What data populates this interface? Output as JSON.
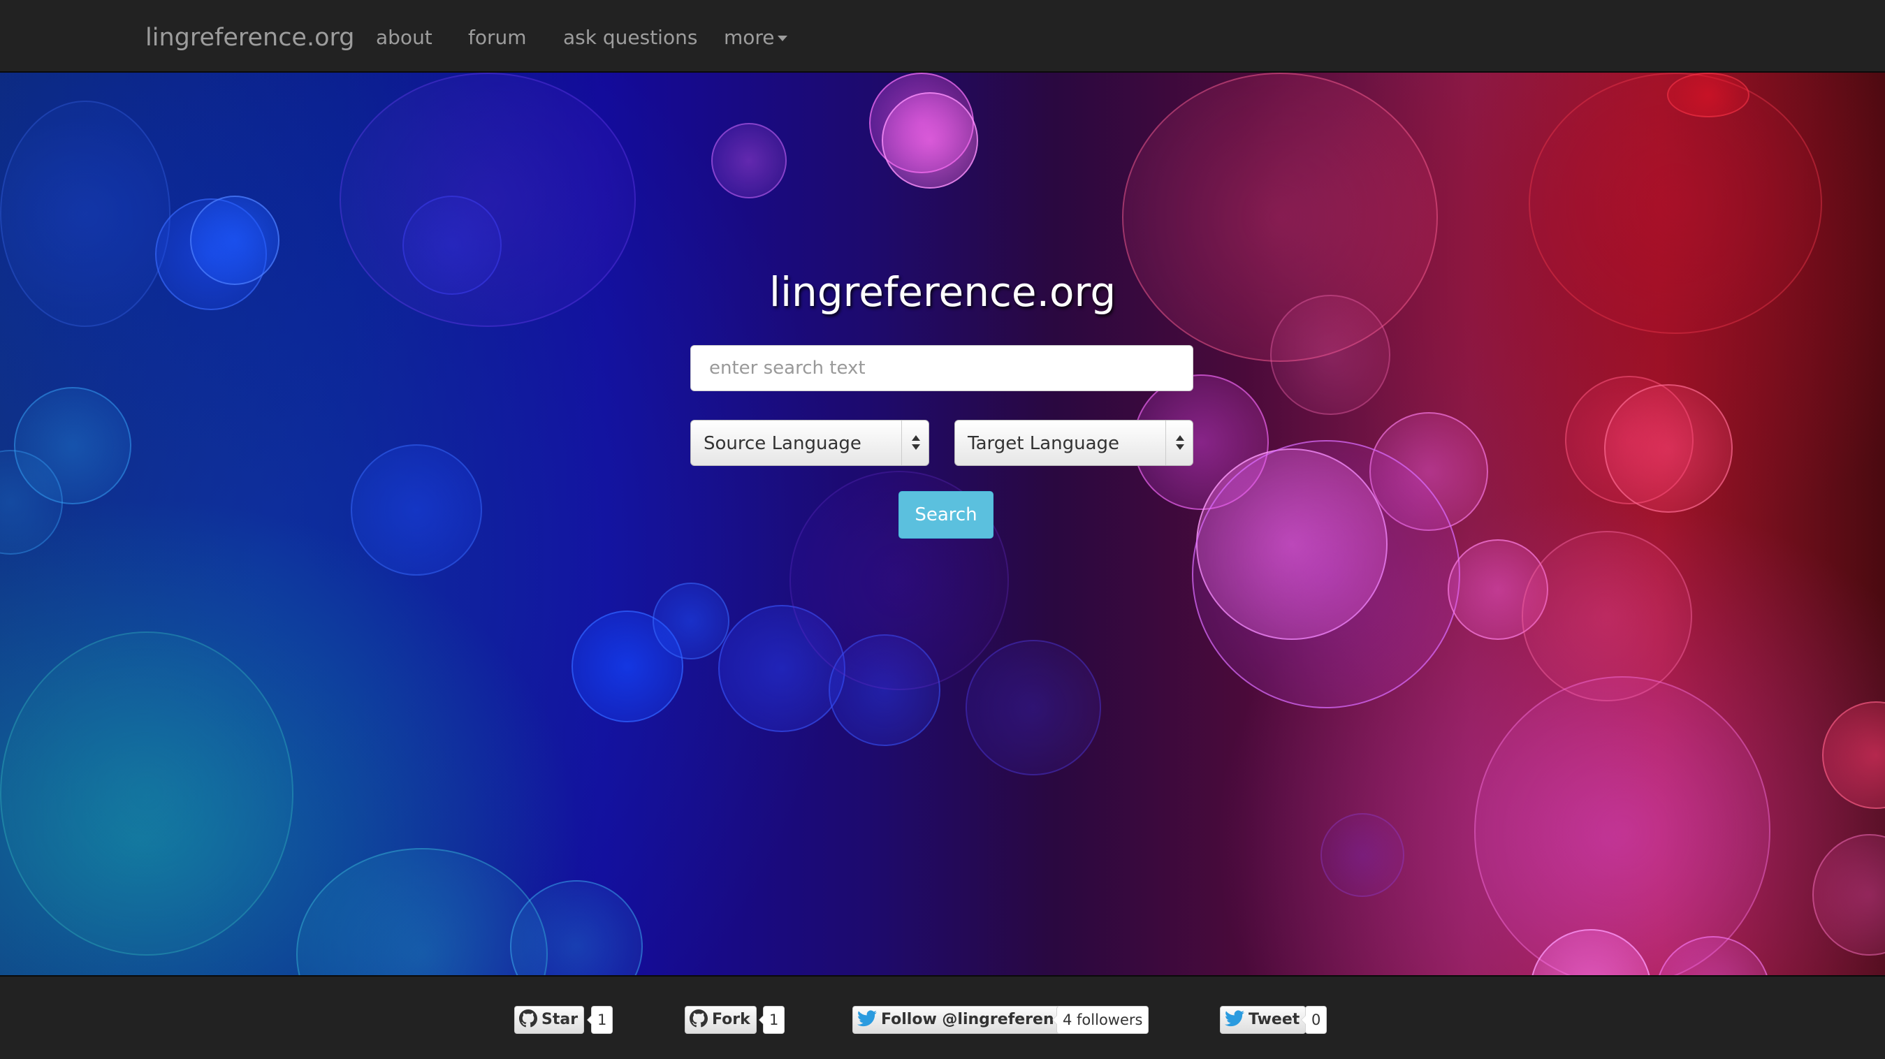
{
  "navbar": {
    "brand": "lingreference.org",
    "items": [
      {
        "label": "about"
      },
      {
        "label": "forum"
      },
      {
        "label": "ask questions"
      },
      {
        "label": "more"
      }
    ]
  },
  "hero": {
    "title": "lingreference.org",
    "search_placeholder": "enter search text",
    "source_language": "Source Language",
    "target_language": "Target Language",
    "search_label": "Search"
  },
  "footer": {
    "github_star": {
      "label": "Star",
      "count": "1",
      "icon": "github-icon"
    },
    "github_fork": {
      "label": "Fork",
      "count": "1",
      "icon": "github-icon"
    },
    "twitter_follow": {
      "label": "Follow @lingreference",
      "count": "4 followers",
      "icon": "twitter-icon"
    },
    "twitter_tweet": {
      "label": "Tweet",
      "count": "0",
      "icon": "twitter-icon"
    }
  },
  "colors": {
    "navbar_bg": "#222222",
    "nav_text": "#9d9d9d",
    "search_button": "#5bc0de"
  }
}
